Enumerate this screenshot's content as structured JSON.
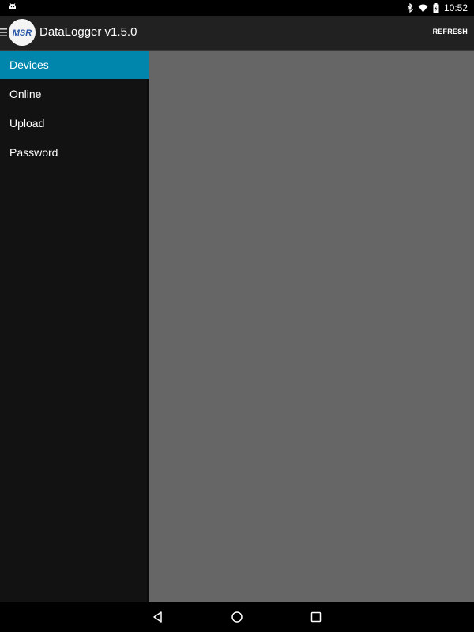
{
  "status_bar": {
    "time": "10:52",
    "left_icon": "android-debug-icon",
    "icons": [
      "bluetooth-icon",
      "wifi-icon",
      "battery-icon"
    ]
  },
  "app_bar": {
    "logo_text": "MSR",
    "title": "DataLogger v1.5.0",
    "refresh_label": "REFRESH"
  },
  "drawer": {
    "items": [
      {
        "label": "Devices",
        "active": true
      },
      {
        "label": "Online",
        "active": false
      },
      {
        "label": "Upload",
        "active": false
      },
      {
        "label": "Password",
        "active": false
      }
    ]
  },
  "nav_bar": {
    "buttons": [
      "back-icon",
      "home-icon",
      "recents-icon"
    ]
  },
  "colors": {
    "accent": "#0085ad",
    "content_bg": "#666666",
    "drawer_bg": "#121212",
    "app_bar_bg": "#212121"
  }
}
